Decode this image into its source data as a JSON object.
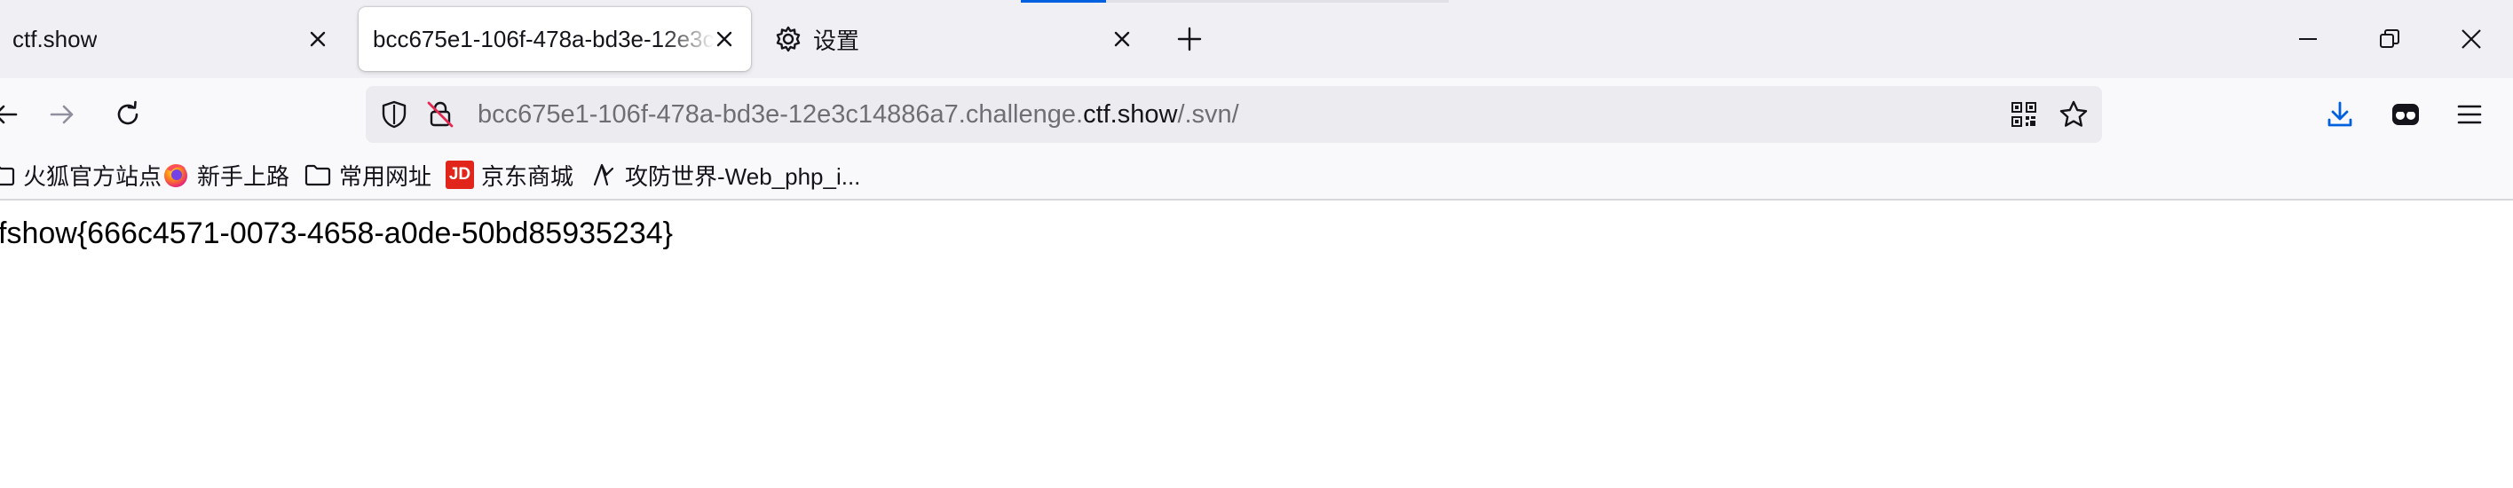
{
  "tabs": [
    {
      "title": "ctf.show",
      "selected": false
    },
    {
      "title": "bcc675e1-106f-478a-bd3e-12e3c",
      "selected": true
    },
    {
      "title": "设置",
      "selected": false,
      "icon": "gear-icon"
    }
  ],
  "window_controls": [
    "minimize-icon",
    "restore-icon",
    "close-icon"
  ],
  "navigation": {
    "url_prefix": "bcc675e1-106f-478a-bd3e-12e3c14886a7.challenge.",
    "url_host": "ctf.show",
    "url_path": "/.svn/",
    "icons": [
      "back-arrow-icon",
      "forward-arrow-icon",
      "reload-icon",
      "shield-icon",
      "insecure-lock-icon",
      "qr-code-icon",
      "star-icon",
      "download-icon",
      "account-icon",
      "menu-icon"
    ]
  },
  "bookmarks": [
    {
      "label": "火狐官方站点",
      "icon": "folder-icon"
    },
    {
      "label": "新手上路",
      "icon": "firefox-icon"
    },
    {
      "label": "常用网址",
      "icon": "folder-icon"
    },
    {
      "label": "京东商城",
      "icon": "jd-icon",
      "icon_text": "JD"
    },
    {
      "label": "攻防世界-Web_php_i...",
      "icon": "bookmark-site-icon"
    }
  ],
  "page": {
    "content": "fshow{666c4571-0073-4658-a0de-50bd85935234}"
  },
  "colors": {
    "tab_strip_bg": "#f0f0f4",
    "toolbar_bg": "#f9f9fb",
    "url_bar_bg": "#ececf0",
    "accent_blue": "#0061e0",
    "jd_red": "#e1251b"
  }
}
